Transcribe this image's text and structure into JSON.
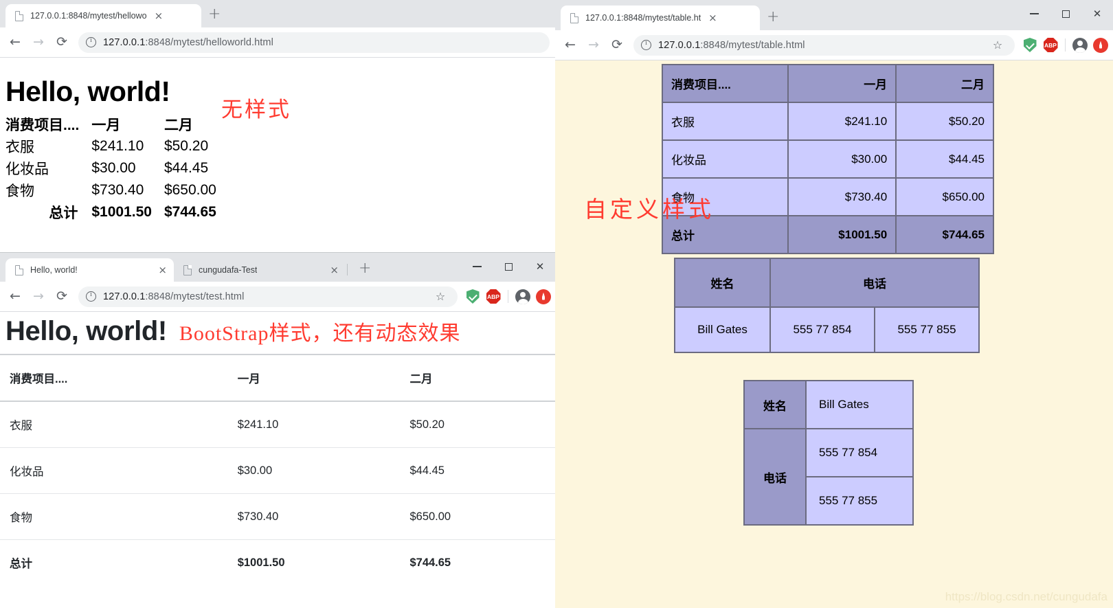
{
  "colors": {
    "tabstrip_bg": "#e3e5e8",
    "omnibox_bg": "#f1f3f4",
    "annotation_red": "#ff3b30",
    "custom_page_bg": "#fdf6dd",
    "custom_table_header_bg": "#9a9ac9",
    "custom_table_cell_bg": "#ccccff",
    "custom_table_border": "#6b6b80"
  },
  "window_plain": {
    "tabs": [
      {
        "title": "127.0.0.1:8848/mytest/hellowo",
        "close": "×",
        "favicon": "page-icon"
      }
    ],
    "newtab_label": "+",
    "toolbar": {
      "back": "←",
      "forward": "→",
      "reload": "⟳",
      "url_host": "127.0.0.1",
      "url_rest": ":8848/mytest/helloworld.html"
    },
    "content": {
      "heading": "Hello, world!",
      "annotation": "无样式",
      "table": {
        "headers": [
          "消费项目....",
          "一月",
          "二月"
        ],
        "rows": [
          [
            "衣服",
            "$241.10",
            "$50.20"
          ],
          [
            "化妆品",
            "$30.00",
            "$44.45"
          ],
          [
            "食物",
            "$730.40",
            "$650.00"
          ]
        ],
        "total": [
          "总计",
          "$1001.50",
          "$744.65"
        ]
      }
    }
  },
  "window_bootstrap": {
    "tabs": [
      {
        "title": "Hello, world!",
        "close": "×",
        "favicon": "page-icon",
        "active": true
      },
      {
        "title": "cungudafa-Test",
        "close": "×",
        "favicon": "page-icon",
        "active": false
      }
    ],
    "newtab_label": "+",
    "window_controls": {
      "minimize": "–",
      "maximize": "□",
      "close": "✕"
    },
    "toolbar": {
      "back": "←",
      "forward": "→",
      "reload": "⟳",
      "url_host": "127.0.0.1",
      "url_rest": ":8848/mytest/test.html",
      "bookmark": "☆",
      "extensions": [
        "adguard-shield-icon",
        "adblock-plus-icon",
        "profile-avatar-icon",
        "red-circle-extension-icon"
      ]
    },
    "content": {
      "heading": "Hello, world!",
      "annotation": "BootStrap样式，还有动态效果",
      "table": {
        "headers": [
          "消费项目....",
          "一月",
          "二月"
        ],
        "rows": [
          [
            "衣服",
            "$241.10",
            "$50.20"
          ],
          [
            "化妆品",
            "$30.00",
            "$44.45"
          ],
          [
            "食物",
            "$730.40",
            "$650.00"
          ]
        ],
        "total": [
          "总计",
          "$1001.50",
          "$744.65"
        ]
      }
    }
  },
  "window_custom": {
    "tabs": [
      {
        "title": "127.0.0.1:8848/mytest/table.ht",
        "close": "×",
        "favicon": "page-icon"
      }
    ],
    "newtab_label": "+",
    "window_controls": {
      "minimize": "–",
      "maximize": "□",
      "close": "✕"
    },
    "toolbar": {
      "back": "←",
      "forward": "→",
      "reload": "⟳",
      "url_host": "127.0.0.1",
      "url_rest": ":8848/mytest/table.html",
      "bookmark": "☆",
      "extensions": [
        "adguard-shield-icon",
        "adblock-plus-icon",
        "profile-avatar-icon",
        "red-circle-extension-icon"
      ]
    },
    "content": {
      "annotation": "自定义样式",
      "watermark": "https://blog.csdn.net/cungudafa",
      "expense_table": {
        "headers": [
          "消费项目....",
          "一月",
          "二月"
        ],
        "rows": [
          [
            "衣服",
            "$241.10",
            "$50.20"
          ],
          [
            "化妆品",
            "$30.00",
            "$44.45"
          ],
          [
            "食物",
            "$730.40",
            "$650.00"
          ]
        ],
        "total": [
          "总计",
          "$1001.50",
          "$744.65"
        ]
      },
      "contact_table_colspan": {
        "headers": [
          "姓名",
          "电话"
        ],
        "row": [
          "Bill Gates",
          "555 77 854",
          "555 77 855"
        ]
      },
      "contact_table_rowspan": {
        "label_name": "姓名",
        "label_phone": "电话",
        "name_value": "Bill Gates",
        "phone_values": [
          "555 77 854",
          "555 77 855"
        ]
      }
    }
  }
}
